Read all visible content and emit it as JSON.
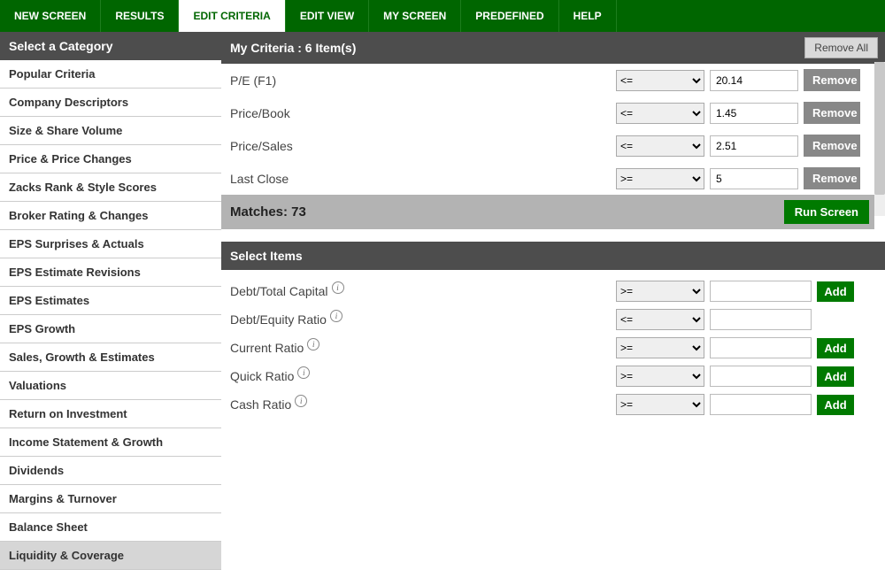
{
  "topnav": {
    "tabs": [
      {
        "id": "new-screen",
        "label": "NEW SCREEN"
      },
      {
        "id": "results",
        "label": "RESULTS"
      },
      {
        "id": "edit-criteria",
        "label": "EDIT CRITERIA",
        "active": true
      },
      {
        "id": "edit-view",
        "label": "EDIT VIEW"
      },
      {
        "id": "my-screen",
        "label": "MY SCREEN"
      },
      {
        "id": "predefined",
        "label": "PREDEFINED"
      },
      {
        "id": "help",
        "label": "HELP"
      }
    ]
  },
  "sidebar": {
    "heading": "Select a Category",
    "items": [
      "Popular Criteria",
      "Company Descriptors",
      "Size & Share Volume",
      "Price & Price Changes",
      "Zacks Rank & Style Scores",
      "Broker Rating & Changes",
      "EPS Surprises & Actuals",
      "EPS Estimate Revisions",
      "EPS Estimates",
      "EPS Growth",
      "Sales, Growth & Estimates",
      "Valuations",
      "Return on Investment",
      "Income Statement & Growth",
      "Dividends",
      "Margins & Turnover",
      "Balance Sheet",
      "Liquidity & Coverage"
    ],
    "selected_index": 17
  },
  "my_criteria": {
    "heading": "My Criteria : 6 Item(s)",
    "remove_all_label": "Remove All",
    "rows": [
      {
        "label": "P/E (F1)",
        "op": "<=",
        "value": "20.14"
      },
      {
        "label": "Price/Book",
        "op": "<=",
        "value": "1.45"
      },
      {
        "label": "Price/Sales",
        "op": "<=",
        "value": "2.51"
      },
      {
        "label": "Last Close",
        "op": ">=",
        "value": "5"
      }
    ],
    "remove_label": "Remove"
  },
  "matches": {
    "label": "Matches: 73",
    "run_label": "Run Screen"
  },
  "select_items": {
    "heading": "Select Items",
    "add_label": "Add",
    "rows": [
      {
        "label": "Debt/Total Capital",
        "op": ">=",
        "show_add": true
      },
      {
        "label": "Debt/Equity Ratio",
        "op": "<=",
        "show_add": false
      },
      {
        "label": "Current Ratio",
        "op": ">=",
        "show_add": true
      },
      {
        "label": "Quick Ratio",
        "op": ">=",
        "show_add": true
      },
      {
        "label": "Cash Ratio",
        "op": ">=",
        "show_add": true
      }
    ]
  },
  "operators": [
    "<=",
    ">=",
    "=",
    "<",
    ">"
  ]
}
